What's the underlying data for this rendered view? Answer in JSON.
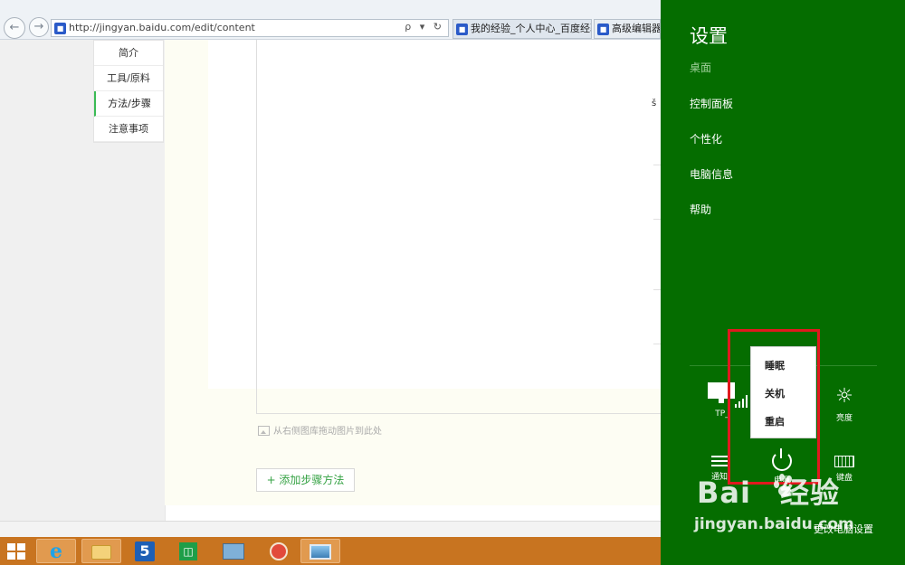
{
  "browser": {
    "back_icon": "back-arrow-icon",
    "forward_icon": "forward-arrow-icon",
    "url": "http://jingyan.baidu.com/edit/content",
    "address_tools": "ρ ▾ ↻",
    "tabs": [
      {
        "label": "我的经验_个人中心_百度经验",
        "active": true
      },
      {
        "label": "高级编辑器_百",
        "active": false
      }
    ]
  },
  "side_nav": {
    "items": [
      {
        "label": "简介"
      },
      {
        "label": "工具/原料"
      },
      {
        "label": "方法/步骤",
        "active": true
      },
      {
        "label": "注意事项"
      }
    ]
  },
  "editor": {
    "stray_char": "š",
    "drop_hint": "从右侧图库拖动图片到此处",
    "add_step_label": "+ 添加步骤方法"
  },
  "taskbar": {
    "icons": [
      "windows-start-icon",
      "internet-explorer-icon",
      "file-explorer-icon",
      "app-5-icon",
      "store-icon",
      "network-icon",
      "tool-icon",
      "photo-viewer-icon"
    ],
    "app_5_text": "5"
  },
  "settings_panel": {
    "title": "设置",
    "subtitle": "桌面",
    "links": [
      "控制面板",
      "个性化",
      "电脑信息",
      "帮助"
    ],
    "quick_settings": {
      "network": "TP_",
      "brightness": "亮度",
      "notifications": "通知",
      "power": "电源",
      "keyboard": "键盘"
    },
    "power_menu": [
      "睡眠",
      "关机",
      "重启"
    ],
    "change_pc_settings": "更改电脑设置",
    "background_color": "#056d00"
  },
  "watermark": {
    "logo_left": "Bai",
    "logo_right": "经验",
    "url": "jingyan.baidu.com"
  },
  "colors": {
    "panel_green": "#056d00",
    "accent_green": "#35a244",
    "taskbar_orange": "#c87420",
    "highlight_red": "#e0191e"
  }
}
